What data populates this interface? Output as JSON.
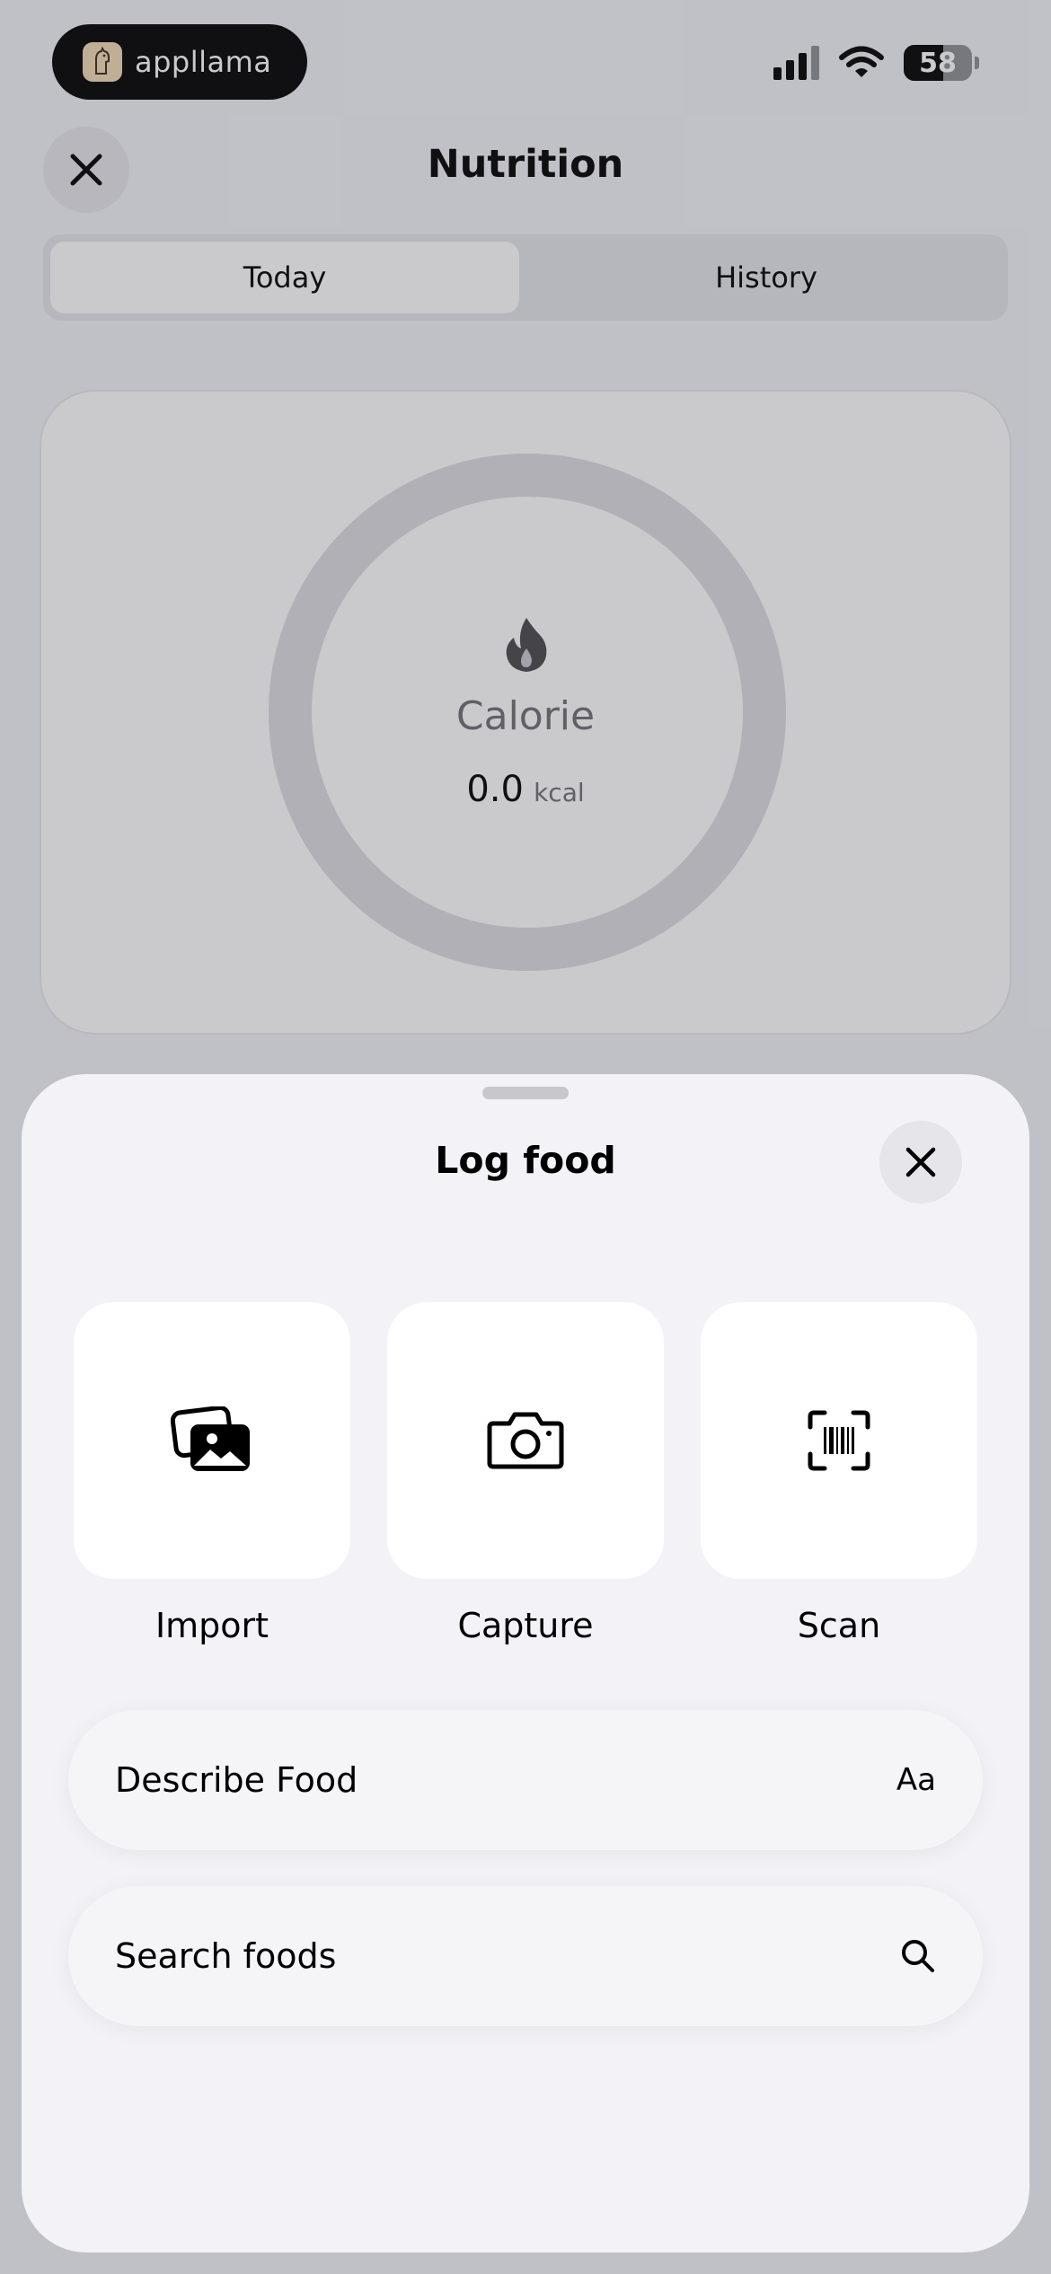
{
  "status_bar": {
    "brand": "appllama",
    "battery_level": "58"
  },
  "header": {
    "title": "Nutrition"
  },
  "tabs": [
    {
      "label": "Today",
      "active": true
    },
    {
      "label": "History",
      "active": false
    }
  ],
  "calorie_card": {
    "label": "Calorie",
    "value": "0.0",
    "unit": "kcal",
    "progress": 0
  },
  "sheet": {
    "title": "Log food",
    "actions": [
      {
        "label": "Import",
        "icon": "photo-stack-icon"
      },
      {
        "label": "Capture",
        "icon": "camera-icon"
      },
      {
        "label": "Scan",
        "icon": "barcode-scan-icon"
      }
    ],
    "describe": {
      "label": "Describe Food",
      "trailing": "Aa"
    },
    "search": {
      "label": "Search foods",
      "icon": "search-icon"
    }
  }
}
